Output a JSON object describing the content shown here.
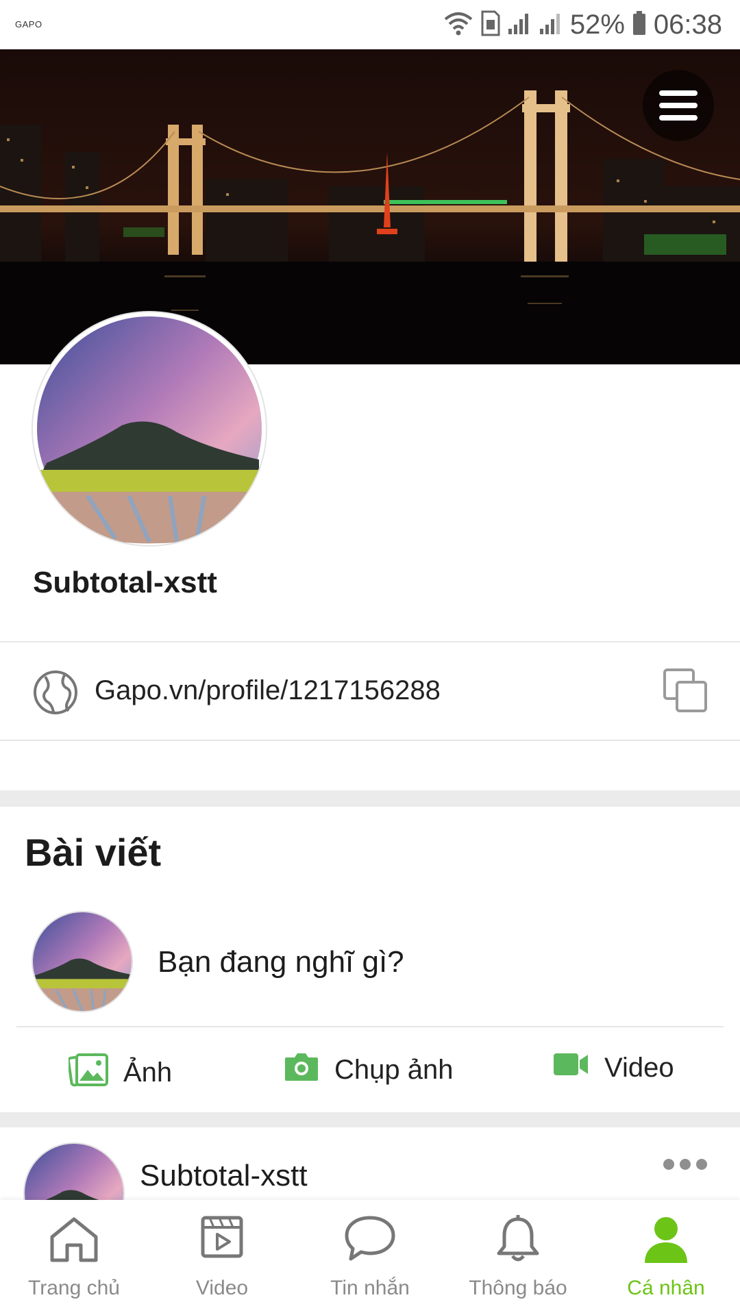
{
  "status_bar": {
    "app_label": "GAPO",
    "battery": "52%",
    "time": "06:38"
  },
  "profile": {
    "name": "Subtotal-xstt",
    "link": "Gapo.vn/profile/1217156288"
  },
  "posts_section": {
    "title": "Bài viết",
    "compose_prompt": "Bạn đang nghĩ gì?",
    "actions": [
      {
        "label": "Ảnh",
        "icon": "photo-gallery-icon"
      },
      {
        "label": "Chụp ảnh",
        "icon": "camera-icon"
      },
      {
        "label": "Video",
        "icon": "video-camera-icon"
      }
    ],
    "first_post": {
      "author": "Subtotal-xstt"
    }
  },
  "tab_bar": {
    "tabs": [
      {
        "label": "Trang chủ",
        "icon": "home-icon",
        "active": false
      },
      {
        "label": "Video",
        "icon": "video-play-icon",
        "active": false
      },
      {
        "label": "Tin nhắn",
        "icon": "chat-bubble-icon",
        "active": false
      },
      {
        "label": "Thông báo",
        "icon": "bell-icon",
        "active": false
      },
      {
        "label": "Cá nhân",
        "icon": "person-icon",
        "active": true
      }
    ]
  },
  "colors": {
    "accent": "#6cc417",
    "icon_green": "#5cb85c"
  }
}
